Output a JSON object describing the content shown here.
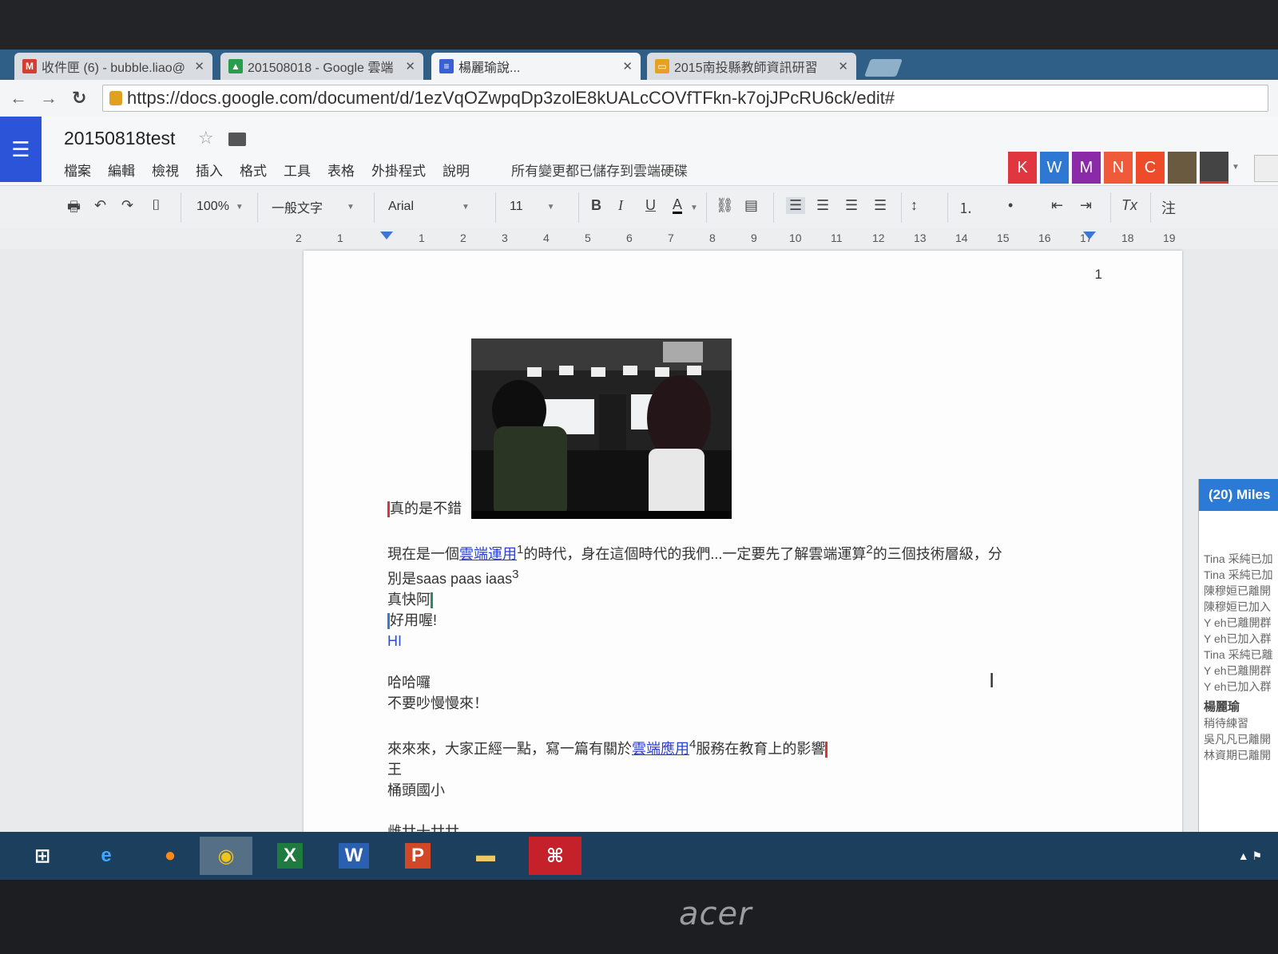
{
  "browser": {
    "tabs": [
      {
        "label": "收件匣 (6) - bubble.liao@",
        "icon": "gmail-icon"
      },
      {
        "label": "201508018 - Google 雲端",
        "icon": "drive-icon"
      },
      {
        "label": "楊麗瑜說...",
        "icon": "docs-icon"
      },
      {
        "label": "2015南投縣教師資訊研習",
        "icon": "slides-icon"
      }
    ],
    "url": "https://docs.google.com/document/d/1ezVqOZwpqDp3zolE8kUALcCOVfTFkn-k7ojJPcRU6ck/edit#"
  },
  "doc": {
    "title": "20150818test",
    "menu": [
      "檔案",
      "編輯",
      "檢視",
      "插入",
      "格式",
      "工具",
      "表格",
      "外掛程式",
      "說明"
    ],
    "save_status": "所有變更都已儲存到雲端硬碟",
    "collaborators": [
      {
        "letter": "K",
        "color": "#e0363f"
      },
      {
        "letter": "W",
        "color": "#2e78d4"
      },
      {
        "letter": "M",
        "color": "#8a2aa8"
      },
      {
        "letter": "N",
        "color": "#ef5a3a"
      },
      {
        "letter": "C",
        "color": "#ee4b2a"
      }
    ]
  },
  "toolbar": {
    "zoom": "100%",
    "style": "一般文字",
    "font": "Arial",
    "size": "11",
    "bold": "B",
    "italic": "I",
    "underline": "U",
    "text_color": "A",
    "clear_format": "Tx",
    "comment": "注"
  },
  "ruler": {
    "ticks": [
      "2",
      "1",
      "1",
      "2",
      "3",
      "4",
      "5",
      "6",
      "7",
      "8",
      "9",
      "10",
      "11",
      "12",
      "13",
      "14",
      "15",
      "16",
      "17",
      "18",
      "19"
    ]
  },
  "page": {
    "number": "1",
    "line1": "真的是不錯",
    "line2_a": "現在是一個",
    "line2_link": "雲端運用",
    "line2_sup1": "1",
    "line2_b": "的時代，身在這個時代的我們...一定要先了解雲端運算",
    "line2_sup2": "2",
    "line2_c": "的三個技術層級，分",
    "line3": "別是saas  paas iaas",
    "line3_sup": "3",
    "line4": "真快阿",
    "line5": "好用喔!",
    "line6": "HI",
    "line7": "哈哈囉",
    "line8": "不要吵慢慢來！",
    "line9_a": "來來來，大家正經一點，寫一篇有關於",
    "line9_link": "雲端應用",
    "line9_sup": "4",
    "line9_b": "服務在教育上的影響",
    "line10": "王",
    "line11": "桶頭國小",
    "line12": "雌廿十廿廿"
  },
  "chat": {
    "header": "(20) Miles",
    "log": [
      "Tina 采純已加",
      "Tina 采純已加",
      "陳穆姮已離開",
      "陳穆姮已加入",
      "Y eh已離開群",
      "Y eh已加入群",
      "Tina 采純已離",
      "Y eh已離開群",
      "Y eh已加入群"
    ],
    "sender": "楊麗瑜",
    "messages": [
      "稍待練習",
      "吳凡凡已離開",
      "林資期已離開"
    ]
  },
  "taskbar": {
    "apps": [
      "start",
      "ie",
      "firefox",
      "chrome",
      "excel",
      "word",
      "powerpoint",
      "explorer",
      "acrobat"
    ]
  },
  "monitor": {
    "brand": "acer"
  }
}
